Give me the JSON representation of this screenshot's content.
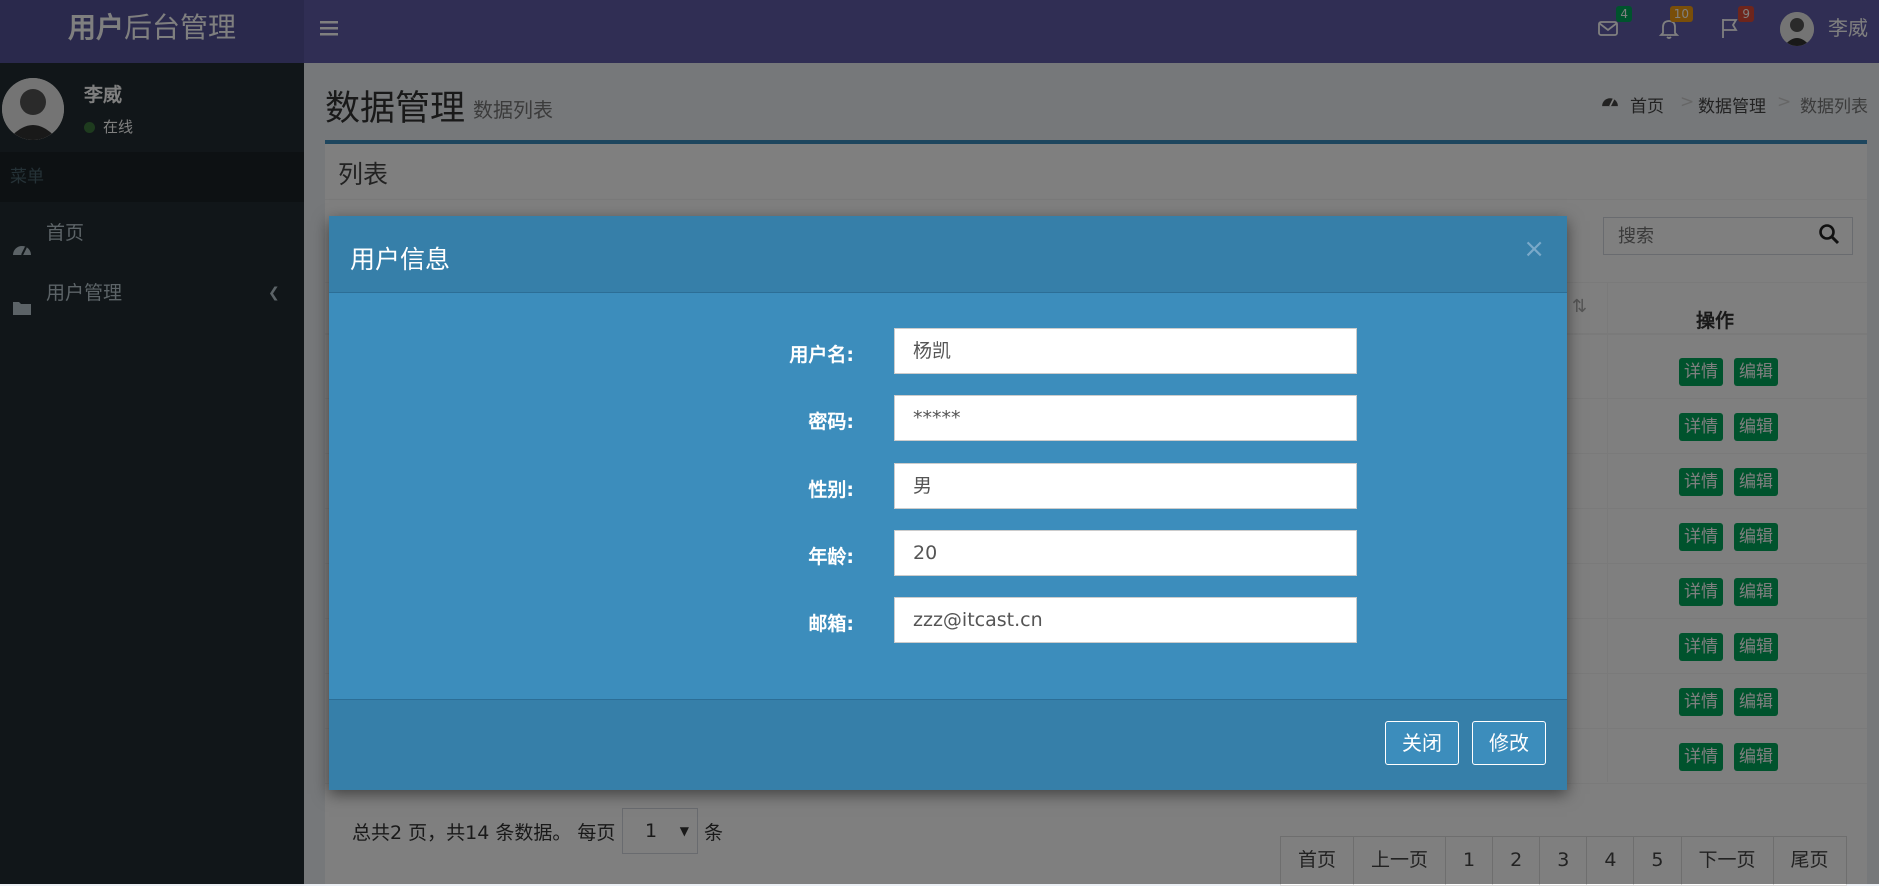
{
  "header": {
    "logo_bold": "用户",
    "logo_rest": "后台管理",
    "mail_badge": "4",
    "bell_badge": "10",
    "flag_badge": "9",
    "user_name": "李威",
    "colors": {
      "bar": "#605ca8",
      "logo": "#555299",
      "mail_badge": "#00a65a",
      "bell_badge": "#f39c12",
      "flag_badge": "#dd4b39"
    }
  },
  "sidebar": {
    "user_name": "李威",
    "status": "在线",
    "header": "菜单",
    "items": [
      {
        "label": "首页",
        "icon": "dashboard-icon"
      },
      {
        "label": "用户管理",
        "icon": "folder-icon"
      }
    ]
  },
  "page": {
    "title": "数据管理",
    "subtitle": "数据列表",
    "breadcrumb": [
      "首页",
      "数据管理",
      "数据列表"
    ]
  },
  "box": {
    "title": "列表",
    "search_placeholder": "搜索",
    "op_header": "操作",
    "row_actions": [
      "详情",
      "编辑"
    ],
    "row_count": 8
  },
  "footer": {
    "info": "总共2 页，共14 条数据。 每页",
    "per_page": "1",
    "unit": "条",
    "pager": [
      "首页",
      "上一页",
      "1",
      "2",
      "3",
      "4",
      "5",
      "下一页",
      "尾页"
    ]
  },
  "modal": {
    "title": "用户信息",
    "close": "×",
    "fields": [
      {
        "label": "用户名:",
        "value": "杨凯"
      },
      {
        "label": "密码:",
        "value": "*****"
      },
      {
        "label": "性别:",
        "value": "男"
      },
      {
        "label": "年龄:",
        "value": "20"
      },
      {
        "label": "邮箱:",
        "value": "zzz@itcast.cn"
      }
    ],
    "close_button": "关闭",
    "submit_button": "修改"
  }
}
